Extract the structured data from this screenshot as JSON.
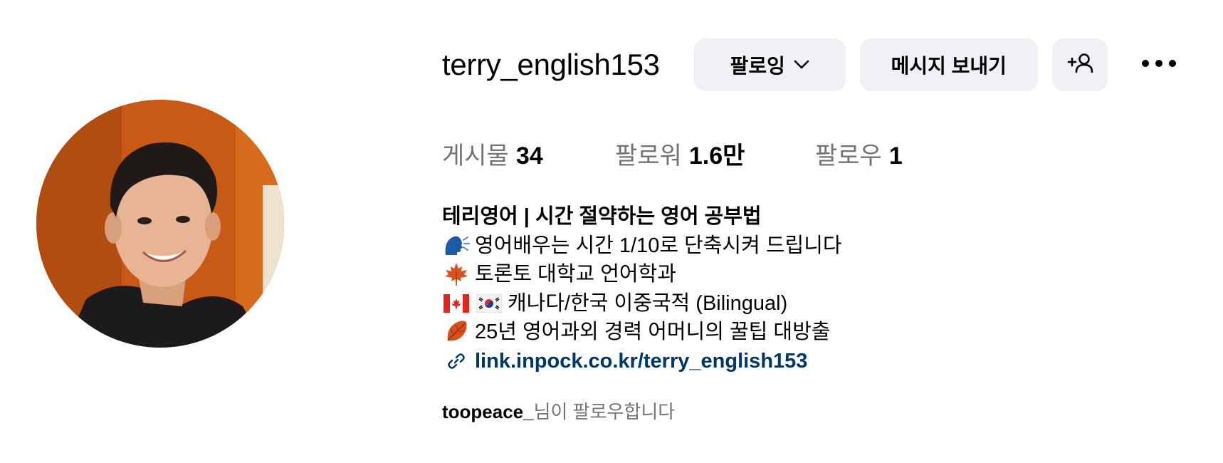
{
  "profile": {
    "username": "terry_english153",
    "avatar_alt": "",
    "buttons": {
      "following_label": "팔로잉",
      "message_label": "메시지 보내기",
      "add_user_icon": "add-person-icon",
      "more_icon": "more-horizontal-icon"
    },
    "stats": {
      "posts_label": "게시물",
      "posts_value": "34",
      "followers_label": "팔로워",
      "followers_value": "1.6만",
      "following_label": "팔로우",
      "following_value": "1"
    },
    "bio": {
      "name": "테리영어 | 시간 절약하는 영어 공부법",
      "lines": [
        {
          "icon": "speaking-head-emoji",
          "text": "영어배우는 시간 1/10로 단축시켜 드립니다"
        },
        {
          "icon": "maple-leaf-emoji",
          "text": "토론토 대학교 언어학과"
        },
        {
          "icon": "canada-korea-flags-emoji",
          "text": "캐나다/한국 이중국적 (Bilingual)"
        },
        {
          "icon": "fallen-leaf-emoji",
          "text": "25년 영어과외 경력 어머니의 꿀팁 대방출"
        }
      ],
      "link_icon": "link-icon",
      "link": "link.inpock.co.kr/terry_english153"
    },
    "followed_by": {
      "user": "toopeace_",
      "suffix": "님이 팔로우합니다"
    }
  },
  "colors": {
    "button_bg": "#eff1f5",
    "link": "#00376b",
    "muted": "#737373",
    "avatar_bg": "#c95a16"
  }
}
